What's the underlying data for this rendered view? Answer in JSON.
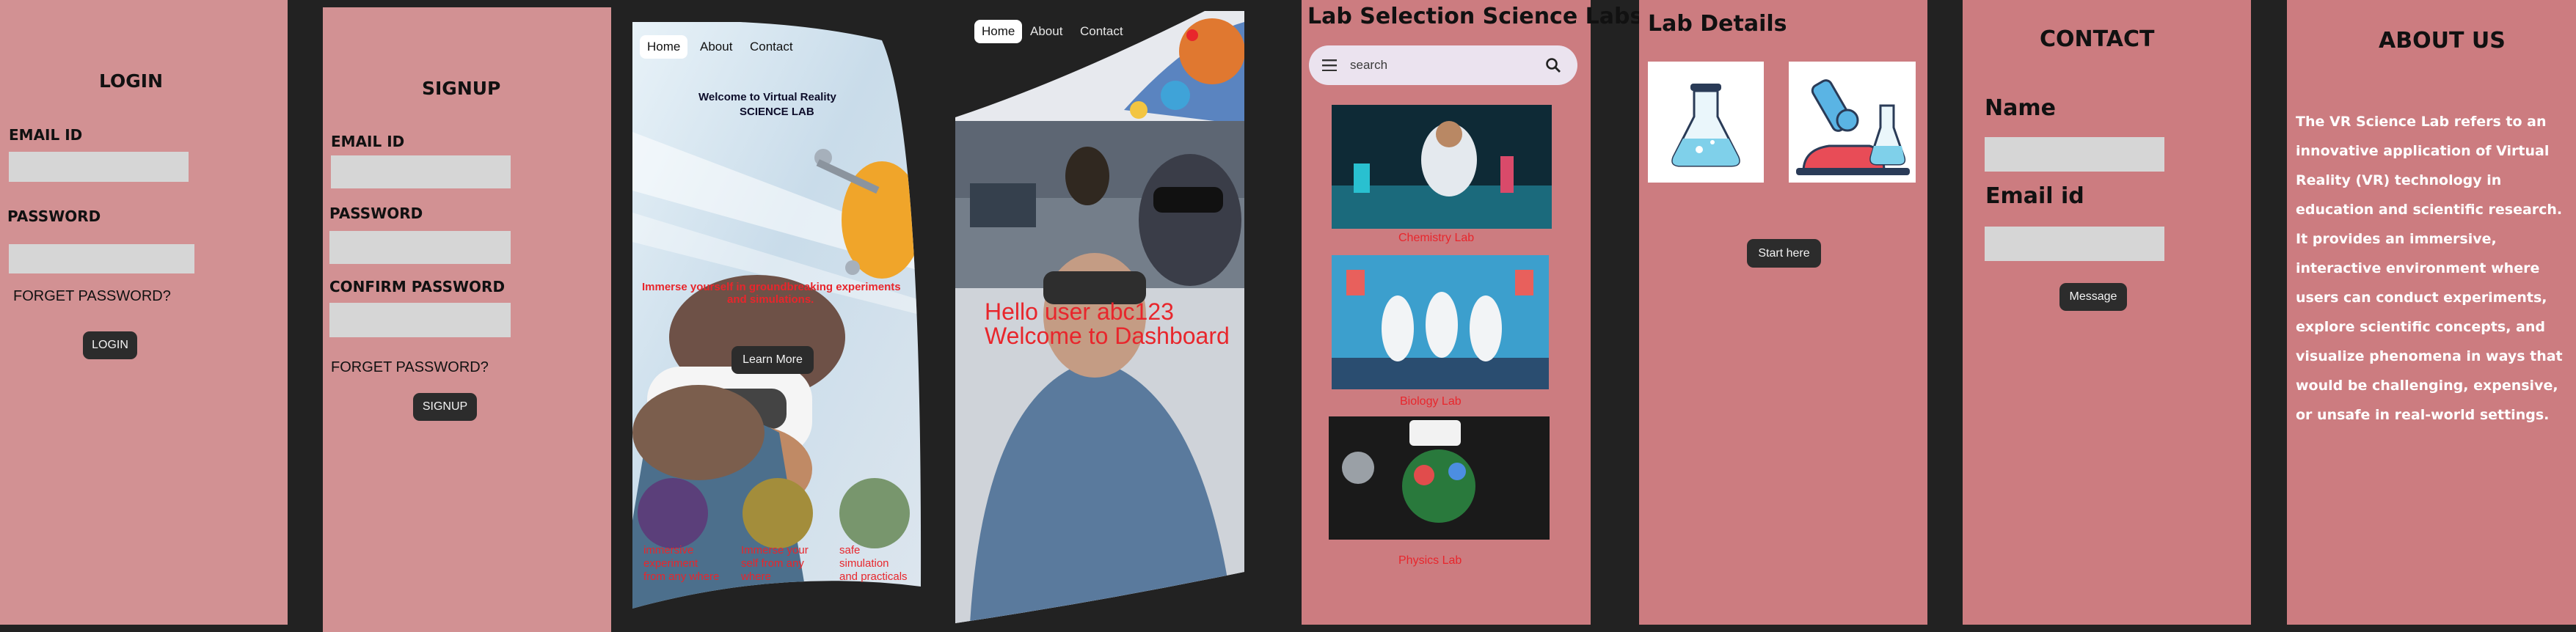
{
  "login": {
    "title": "LOGIN",
    "email_label": "EMAIL ID",
    "password_label": "PASSWORD",
    "forget": "FORGET PASSWORD?",
    "button": "LOGIN"
  },
  "signup": {
    "title": "SIGNUP",
    "email_label": "EMAIL ID",
    "password_label": "PASSWORD",
    "confirm_label": "CONFIRM PASSWORD",
    "forget": "FORGET PASSWORD?",
    "button": "SIGNUP"
  },
  "home": {
    "nav": [
      "Home",
      "About",
      "Contact"
    ],
    "welcome_line1": "Welcome to Virtual Reality",
    "welcome_line2": "SCIENCE LAB",
    "tagline_line1": "Immerse yourself in groundbreaking experiments",
    "tagline_line2": "and simulations.",
    "button": "Learn More",
    "features": [
      {
        "line1": "immersive",
        "line2": "experiment",
        "line3": "from any where"
      },
      {
        "line1": "Immerse your",
        "line2": "self from any",
        "line3": "where"
      },
      {
        "line1": "safe",
        "line2": "simulation",
        "line3": "and practicals"
      }
    ]
  },
  "dashboard": {
    "nav": [
      "Home",
      "About",
      "Contact"
    ],
    "hello": "Hello user abc123",
    "welcome": "Welcome to Dashboard"
  },
  "lab_selection": {
    "title": "Lab Selection Science Labs",
    "search_placeholder": "search",
    "labs": [
      "Chemistry Lab",
      "Biology Lab",
      "Physics Lab"
    ]
  },
  "lab_details": {
    "title": "Lab Details",
    "button": "Start here"
  },
  "contact": {
    "title": "CONTACT",
    "name_label": "Name",
    "email_label": "Email id",
    "button": "Message"
  },
  "about": {
    "title": "ABOUT US",
    "body": "The VR Science Lab refers to an innovative application of Virtual Reality (VR) technology in education and scientific research. It provides an immersive, interactive environment where users can conduct experiments, explore scientific concepts, and visualize phenomena in ways that would be challenging, expensive, or unsafe in real-world settings."
  },
  "colors": {
    "background": "#222222",
    "panel_pink": "#d29193",
    "panel_rose": "#cc7c80",
    "field_gray": "#d6d6d6",
    "button_dark": "#2c2c2c",
    "caption_red": "#e8262c"
  }
}
